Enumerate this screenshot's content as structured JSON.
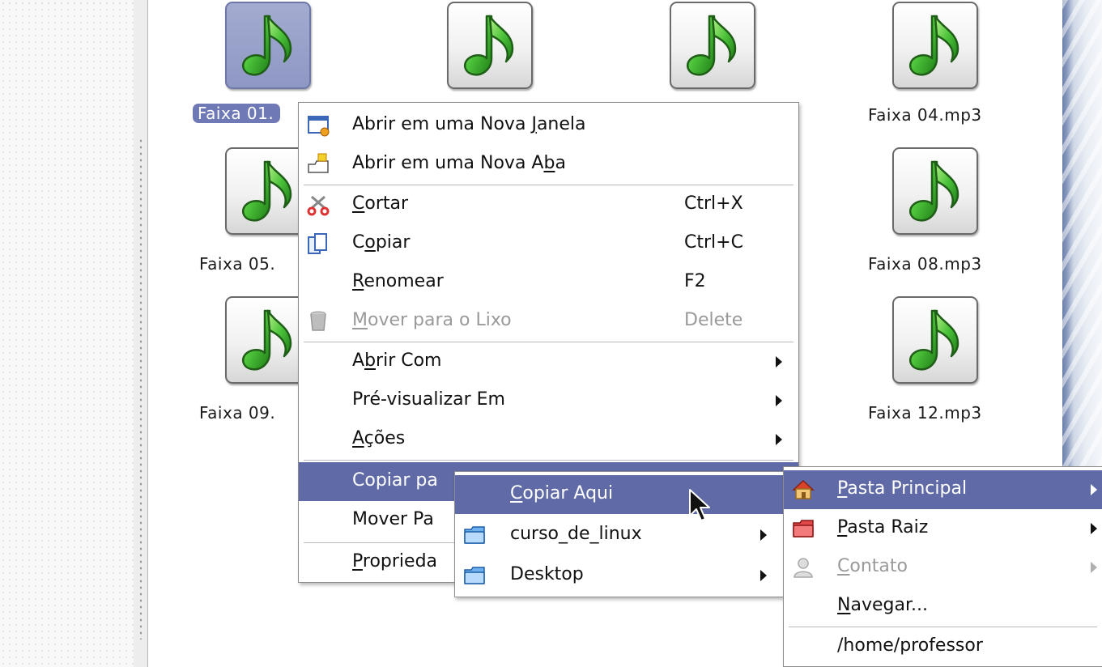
{
  "files": [
    {
      "label": "Faixa 01.",
      "selected": true
    },
    {
      "label": "Faixa 04.mp3"
    },
    {
      "label": "Faixa 05."
    },
    {
      "label": "Faixa 08.mp3"
    },
    {
      "label": "Faixa 09."
    },
    {
      "label": "Faixa 12.mp3"
    }
  ],
  "context_menu": {
    "items": [
      {
        "pre": "Abrir em uma Nova ",
        "u": "J",
        "post": "anela",
        "icon": "new-window-icon"
      },
      {
        "pre": "Abrir em uma Nova A",
        "u": "b",
        "post": "a",
        "icon": "new-tab-icon"
      },
      {
        "pre": "",
        "u": "C",
        "post": "ortar",
        "shortcut": "Ctrl+X",
        "icon": "scissors-icon"
      },
      {
        "pre": "C",
        "u": "o",
        "post": "piar",
        "shortcut": "Ctrl+C",
        "icon": "copy-icon"
      },
      {
        "pre": "",
        "u": "R",
        "post": "enomear",
        "shortcut": "F2"
      },
      {
        "pre": "",
        "u": "M",
        "post": "over para o Lixo",
        "shortcut": "Delete",
        "icon": "trash-icon",
        "disabled": true
      },
      {
        "pre": "A",
        "u": "b",
        "post": "rir Com",
        "submenu": true
      },
      {
        "pre": "Pré-visualizar Em",
        "u": "",
        "post": "",
        "submenu": true
      },
      {
        "pre": "",
        "u": "A",
        "post": "ções",
        "submenu": true
      },
      {
        "pre": "Copiar pa",
        "u": "",
        "post": "",
        "highlighted": true
      },
      {
        "pre": "Mover Pa",
        "u": "",
        "post": ""
      },
      {
        "pre": "",
        "u": "P",
        "post": "roprieda"
      }
    ]
  },
  "copy_submenu": {
    "items": [
      {
        "pre": "",
        "u": "C",
        "post": "opiar Aqui",
        "highlighted": true
      },
      {
        "pre": "curso_de_linux",
        "u": "",
        "post": "",
        "icon": "folder-icon",
        "submenu": true
      },
      {
        "pre": "Desktop",
        "u": "",
        "post": "",
        "icon": "folder-icon",
        "submenu": true
      }
    ]
  },
  "places_submenu": {
    "items": [
      {
        "pre": "",
        "u": "P",
        "post": "asta Principal",
        "icon": "home-icon",
        "submenu": true,
        "highlighted": true
      },
      {
        "pre": "",
        "u": "P",
        "post": "asta Raiz",
        "icon": "red-folder-icon",
        "submenu": true
      },
      {
        "pre": "",
        "u": "C",
        "post": "ontato",
        "icon": "contact-icon",
        "submenu": true,
        "disabled": true
      },
      {
        "pre": "",
        "u": "N",
        "post": "avegar...",
        "icon": ""
      },
      {
        "pre": "/home/professor",
        "u": "",
        "post": ""
      }
    ]
  },
  "colors": {
    "selection": "#5f6aa6",
    "note_green": "#3fb531"
  }
}
